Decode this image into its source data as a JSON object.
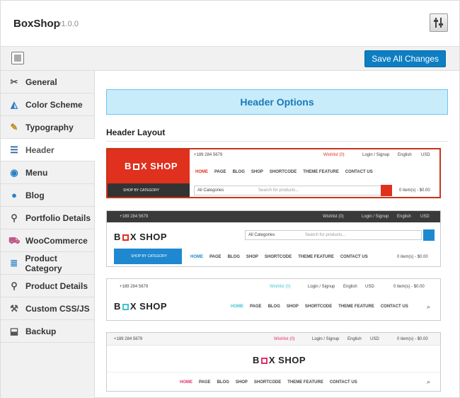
{
  "app": {
    "title": "BoxShop",
    "version": "v1.0.0",
    "save_label": "Save All Changes"
  },
  "sidebar": {
    "items": [
      {
        "label": "General",
        "icon": "tools-icon"
      },
      {
        "label": "Color Scheme",
        "icon": "paint-bucket-icon"
      },
      {
        "label": "Typography",
        "icon": "pencil-note-icon"
      },
      {
        "label": "Header",
        "icon": "header-lines-icon",
        "active": true
      },
      {
        "label": "Menu",
        "icon": "menu-circle-icon"
      },
      {
        "label": "Blog",
        "icon": "comments-icon"
      },
      {
        "label": "Portfolio Details",
        "icon": "magnifier-icon"
      },
      {
        "label": "WooCommerce",
        "icon": "cart-icon"
      },
      {
        "label": "Product Category",
        "icon": "list-icon"
      },
      {
        "label": "Product Details",
        "icon": "magnifier-icon"
      },
      {
        "label": "Custom CSS/JS",
        "icon": "wrench-icon"
      },
      {
        "label": "Backup",
        "icon": "backup-icon"
      }
    ]
  },
  "main": {
    "section_title": "Header Options",
    "layout_heading": "Header Layout"
  },
  "previews": {
    "common": {
      "phone": "+189 284 5679",
      "wishlist": "Wishlist (0)",
      "login": "Login / Signup",
      "language": "English",
      "currency": "USD",
      "categories": "All Categories",
      "search_placeholder": "Search for products...",
      "shop_by_category": "SHOP BY CATEGORY",
      "cart": "0 item(s) - $0.00",
      "logo_left": "B",
      "logo_right": "X SHOP"
    },
    "menu": [
      "HOME",
      "PAGE",
      "BLOG",
      "SHOP",
      "SHORTCODE",
      "THEME FEATURE",
      "CONTACT US"
    ]
  },
  "colors": {
    "primary": "#0d7ec2",
    "banner_bg": "#c9ecfb",
    "accent_red": "#e0301e",
    "blue_bar": "#1e88d0"
  }
}
